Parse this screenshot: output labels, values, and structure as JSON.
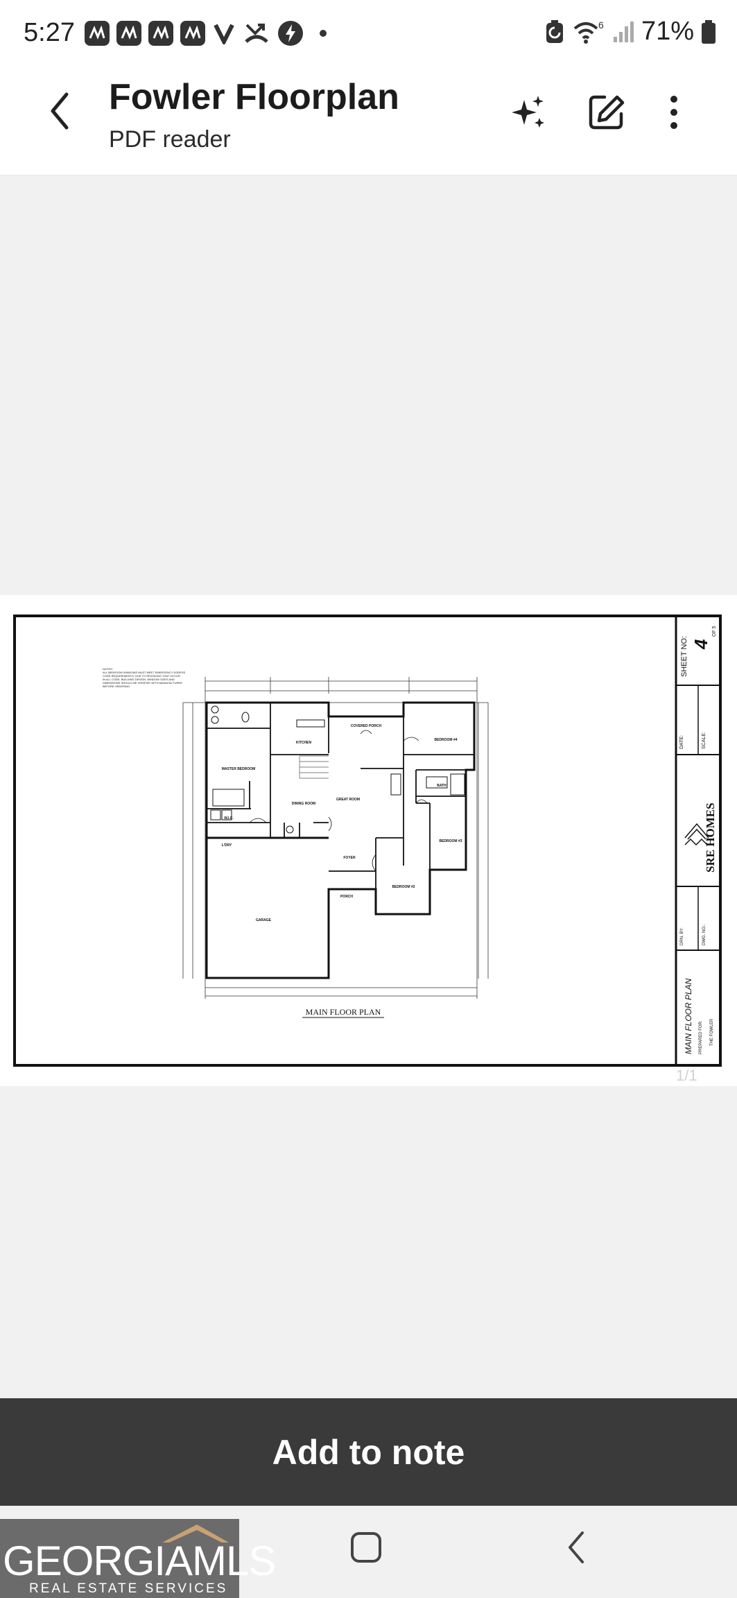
{
  "status_bar": {
    "time": "5:27",
    "notification_icons": [
      "n-app-icon",
      "n-app-icon",
      "n-app-icon",
      "n-app-icon",
      "v-app-icon",
      "missed-call-icon",
      "lightning-app-icon",
      "dot-icon"
    ],
    "battery_text": "71%"
  },
  "app_bar": {
    "title": "Fowler Floorplan",
    "subtitle": "PDF reader"
  },
  "document": {
    "notes_text": "NOTES:\nALL BEDROOM WINDOWS MUST MEET EMERGENCY EGRESS\nCODE REQUIREMENTS. DUE TO REVISIONS THAT OCCUR\nIN ALL CODE, BUILDING DESIGN, WINDOW SIZES AND\nDIMENSIONS SHOULD BE VERIFIED WITH MANUFACTURER\nBEFORE ORDERING.",
    "rooms": {
      "master": "MASTER BEDROOM",
      "kitchen": "KITCHEN",
      "covered_porch": "COVERED PORCH",
      "bedroom4": "BEDROOM #4",
      "dining": "DINING ROOM",
      "great": "GREAT ROOM",
      "bath": "BATH",
      "wic": "W.I.C.",
      "bedroom3": "BEDROOM #3",
      "laundry": "L'DRY",
      "foyer": "FOYER",
      "porch": "PORCH",
      "bedroom2": "BEDROOM #2",
      "garage": "GARAGE"
    },
    "plan_label": "MAIN FLOOR PLAN",
    "sheet_label": "SHEET NO:",
    "sheet_number": "4",
    "sheet_of": "OF 5",
    "date_label": "DATE:",
    "scale_label": "SCALE:",
    "company": "SRE HOMES",
    "drawn_by_label": "DRN. BY:",
    "dwg_no_label": "DWG. NO.:",
    "sheet_title": "MAIN FLOOR PLAN",
    "prepared_for": "PREPARED FOR:",
    "client": "THE FOWLER",
    "page_indicator": "1/1"
  },
  "add_note_label": "Add to note",
  "watermark": {
    "main": "GEORGIAMLS",
    "sub": "REAL ESTATE SERVICES"
  }
}
